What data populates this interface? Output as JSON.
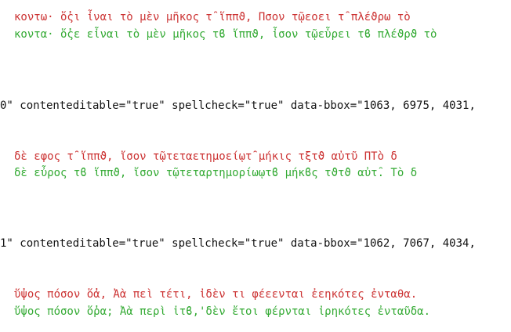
{
  "colors": {
    "original_text": "#cc3333",
    "corrected_text": "#33aa33",
    "markup_text": "#111111"
  },
  "blocks": [
    {
      "original": "κοντω· ὅ̓ςι ἶναι τὸ μὲν μῆκος τ̑ ἵππϑ, Πσον τῷεοει τ̑ πλέϑρω τὸ",
      "corrected": "κοντα· ὅ̓ςε εἶναι τὸ μὲν μῆκος τϐ ἵππϑ, ἶσον τῷεὗρει τϐ πλέϑρϑ τὸ"
    },
    {
      "markup": "0\" contenteditable=\"true\" spellcheck=\"true\" data-bbox=\"1063, 6975, 4031,"
    },
    {
      "original": "δὲ εφος τ̑ ἵππϑ, ἴσον τῷτεταετημοείῳτ̑ μήκις τξτϑ αὐτῦ ΠΤὸ δ",
      "corrected": "δὲ εὖρος τϐ ἵππϑ, ἴσον τῷτεταρτημορίωῳτϐ μήκϐς τϑτϑ αὐτ̑. Τὸ δ"
    },
    {
      "markup": "1\" contenteditable=\"true\" spellcheck=\"true\" data-bbox=\"1062, 7067, 4034,"
    },
    {
      "original": "ὕ̓ψος πόσον ὅ̓α, Ἀὰ πεὶ τέτι, ἰδὲν τι φέεενται ἐεηκότες ἐνταθα.",
      "corrected": "ὕ̓ψος πόσον ὅ̓ρα; Ἀὰ περὶ ἱτϐ,'δὲν ἔτοι φέρνται ἰρηκότες ἐνταῦδα."
    }
  ]
}
